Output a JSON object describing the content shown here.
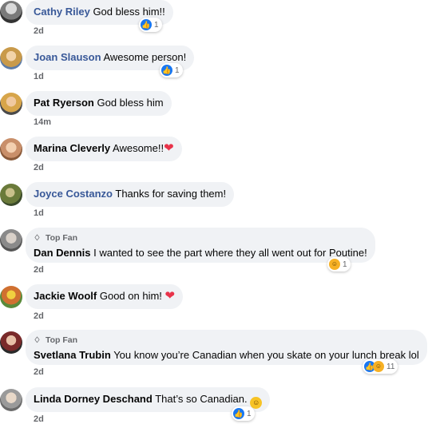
{
  "comments": [
    {
      "name": "Cathy Riley",
      "text": "God bless him!!",
      "time": "2d",
      "reaction_count": "1"
    },
    {
      "name": "Joan Slauson",
      "text": "Awesome person!",
      "time": "1d",
      "reaction_count": "1"
    },
    {
      "name": "Pat Ryerson",
      "text": "God bless him",
      "time": "14m"
    },
    {
      "name": "Marina Cleverly",
      "text": "Awesome!!",
      "time": "2d"
    },
    {
      "name": "Joyce Costanzo",
      "text": "Thanks for saving them!",
      "time": "1d"
    },
    {
      "badge": "Top Fan",
      "name": "Dan Dennis",
      "text": "I wanted to see the part where they all went out for Poutine!",
      "time": "2d",
      "reaction_count": "1"
    },
    {
      "name": "Jackie Woolf",
      "text": "Good on him!",
      "time": "2d"
    },
    {
      "badge": "Top Fan",
      "name": "Svetlana Trubin",
      "text": "You know you’re Canadian when you skate on your lunch break lol",
      "time": "2d",
      "reaction_count": "11"
    },
    {
      "name": "Linda Dorney Deschand",
      "text": "That’s so Canadian.",
      "time": "2d",
      "reaction_count": "1"
    }
  ],
  "icons": {
    "like": "like-icon",
    "haha": "haha-icon",
    "heart": "heart-emoji",
    "top_fan": "diamond-icon"
  },
  "colors": {
    "like": "#1877f2",
    "haha": "#f7b125",
    "name_link": "#385898",
    "bubble": "#f0f2f5",
    "meta": "#65676b"
  }
}
